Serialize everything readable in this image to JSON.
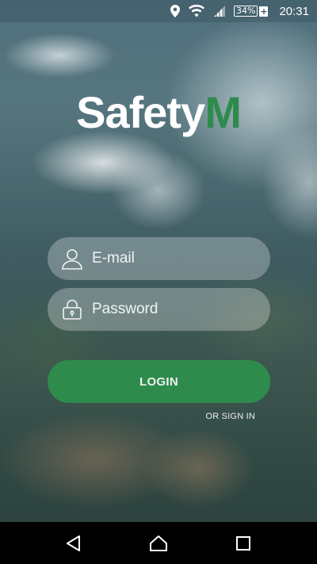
{
  "status_bar": {
    "battery_percent": "34%",
    "battery_charging_glyph": "+",
    "time": "20:31",
    "icons": [
      "location-icon",
      "wifi-icon",
      "signal-icon",
      "battery-icon"
    ]
  },
  "logo": {
    "main_text": "Safety",
    "accent_text": "M",
    "accent_color": "#2e8b4c"
  },
  "form": {
    "email": {
      "placeholder": "E-mail",
      "value": "",
      "icon": "user-icon"
    },
    "password": {
      "placeholder": "Password",
      "value": "",
      "icon": "lock-icon"
    },
    "login_label": "LOGIN",
    "signin_link": "OR SIGN IN",
    "button_color": "#2e8b4c"
  },
  "nav_bar": {
    "items": [
      "back-icon",
      "home-icon",
      "recents-icon"
    ]
  }
}
